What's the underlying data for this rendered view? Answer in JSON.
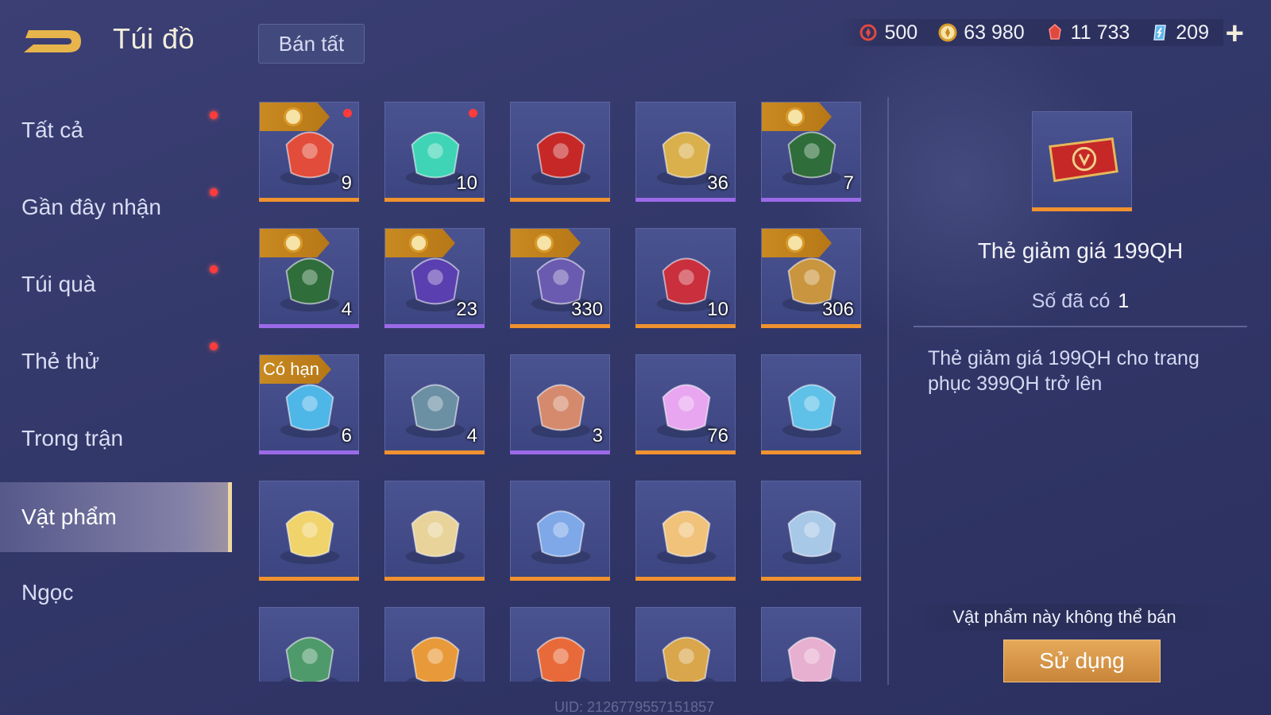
{
  "header": {
    "title": "Túi đồ",
    "sell_all_label": "Bán tất",
    "currencies": [
      {
        "icon": "red-token-icon",
        "value": "500",
        "color": "#e0493f"
      },
      {
        "icon": "gold-coin-icon",
        "value": "63 980",
        "color": "#e7c15a"
      },
      {
        "icon": "ruby-icon",
        "value": "11 733",
        "color": "#e0493f"
      },
      {
        "icon": "crystal-icon",
        "value": "209",
        "color": "#5fb6f0"
      }
    ],
    "plus_label": "+"
  },
  "sidebar": {
    "items": [
      {
        "label": "Tất cả",
        "dot": true
      },
      {
        "label": "Gần đây nhận",
        "dot": true
      },
      {
        "label": "Túi quà",
        "dot": true
      },
      {
        "label": "Thẻ thử",
        "dot": true
      },
      {
        "label": "Trong trận",
        "dot": false
      },
      {
        "label": "Vật phẩm",
        "dot": false,
        "active": true
      },
      {
        "label": "Ngọc",
        "dot": false
      }
    ]
  },
  "grid": {
    "items": [
      {
        "icon": "bouquet-gift-icon",
        "count": "9",
        "tag": "coin",
        "reddot": true,
        "rarity": "orange"
      },
      {
        "icon": "thumbs-up-icon",
        "count": "10",
        "tag": "",
        "reddot": true,
        "rarity": "orange"
      },
      {
        "icon": "discount-ticket-icon",
        "count": "",
        "tag": "",
        "reddot": false,
        "rarity": "orange"
      },
      {
        "icon": "golden-hammer-icon",
        "count": "36",
        "tag": "",
        "reddot": false,
        "rarity": "purple"
      },
      {
        "icon": "double-coin-card-icon",
        "count": "7",
        "tag": "coin",
        "reddot": false,
        "rarity": "purple"
      },
      {
        "icon": "double-coin-card-icon",
        "count": "4",
        "tag": "coin",
        "reddot": false,
        "rarity": "purple"
      },
      {
        "icon": "purple-crest-card-icon",
        "count": "23",
        "tag": "coin",
        "reddot": false,
        "rarity": "purple"
      },
      {
        "icon": "helmet-card-icon",
        "count": "330",
        "tag": "coin",
        "reddot": false,
        "rarity": "orange"
      },
      {
        "icon": "red-gem-emblem-icon",
        "count": "10",
        "tag": "",
        "reddot": false,
        "rarity": "orange"
      },
      {
        "icon": "golden-armor-card-icon",
        "count": "306",
        "tag": "coin",
        "reddot": false,
        "rarity": "orange"
      },
      {
        "icon": "2025-badge-icon",
        "count": "6",
        "tag": "text",
        "tag_label": "Có hạn",
        "reddot": false,
        "rarity": "purple"
      },
      {
        "icon": "scroll-map-icon",
        "count": "4",
        "tag": "",
        "reddot": false,
        "rarity": "orange"
      },
      {
        "icon": "amber-crystal-icon",
        "count": "3",
        "tag": "",
        "reddot": false,
        "rarity": "purple"
      },
      {
        "icon": "rainbow-star-icon",
        "count": "76",
        "tag": "",
        "reddot": false,
        "rarity": "orange"
      },
      {
        "icon": "blue-jelly-plate-icon",
        "count": "",
        "tag": "",
        "reddot": false,
        "rarity": "orange"
      },
      {
        "icon": "cake-plate-icon",
        "count": "",
        "tag": "",
        "reddot": false,
        "rarity": "orange"
      },
      {
        "icon": "dumpling-bowl-icon",
        "count": "",
        "tag": "",
        "reddot": false,
        "rarity": "orange"
      },
      {
        "icon": "star-jelly-plate-icon",
        "count": "",
        "tag": "",
        "reddot": false,
        "rarity": "orange"
      },
      {
        "icon": "pastry-plate-icon",
        "count": "",
        "tag": "",
        "reddot": false,
        "rarity": "orange"
      },
      {
        "icon": "mochi-plate-icon",
        "count": "",
        "tag": "",
        "reddot": false,
        "rarity": "orange"
      },
      {
        "icon": "green-emblem-card-icon",
        "count": "",
        "tag": "",
        "reddot": false,
        "rarity": "orange"
      },
      {
        "icon": "anniversary-ticket-icon",
        "count": "",
        "tag": "",
        "reddot": false,
        "rarity": "orange"
      },
      {
        "icon": "fruit-tea-cup-icon",
        "count": "",
        "tag": "",
        "reddot": false,
        "rarity": "orange"
      },
      {
        "icon": "golden-teapot-icon",
        "count": "",
        "tag": "",
        "reddot": false,
        "rarity": "orange"
      },
      {
        "icon": "pink-bat-creature-icon",
        "count": "",
        "tag": "",
        "reddot": false,
        "rarity": "orange"
      }
    ]
  },
  "detail": {
    "name": "Thẻ giảm giá 199QH",
    "owned_label": "Số đã có",
    "owned_value": "1",
    "description": "Thẻ giảm giá 199QH cho trang phục 399QH trở lên",
    "notice": "Vật phẩm này không thể bán",
    "use_label": "Sử dụng"
  },
  "uid": "UID: 2126779557151857"
}
